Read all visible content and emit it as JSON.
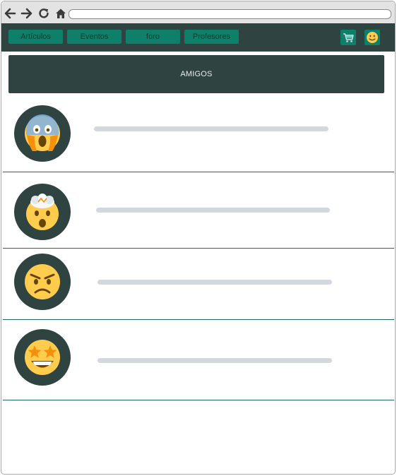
{
  "nav": {
    "items": [
      {
        "label": "Artículos"
      },
      {
        "label": "Eventos"
      },
      {
        "label": "foro"
      },
      {
        "label": "Profesores"
      }
    ]
  },
  "banner": {
    "title": "AMIGOS"
  },
  "friends": [
    {
      "emoji_icon": "face-screaming-in-fear-icon"
    },
    {
      "emoji_icon": "exploding-head-icon"
    },
    {
      "emoji_icon": "angry-face-icon"
    },
    {
      "emoji_icon": "star-struck-icon"
    }
  ],
  "colors": {
    "appbar": "#2f4440",
    "button": "#0e7f69",
    "divider": "#176c5d",
    "placeholder_line": "#d2d8de"
  }
}
